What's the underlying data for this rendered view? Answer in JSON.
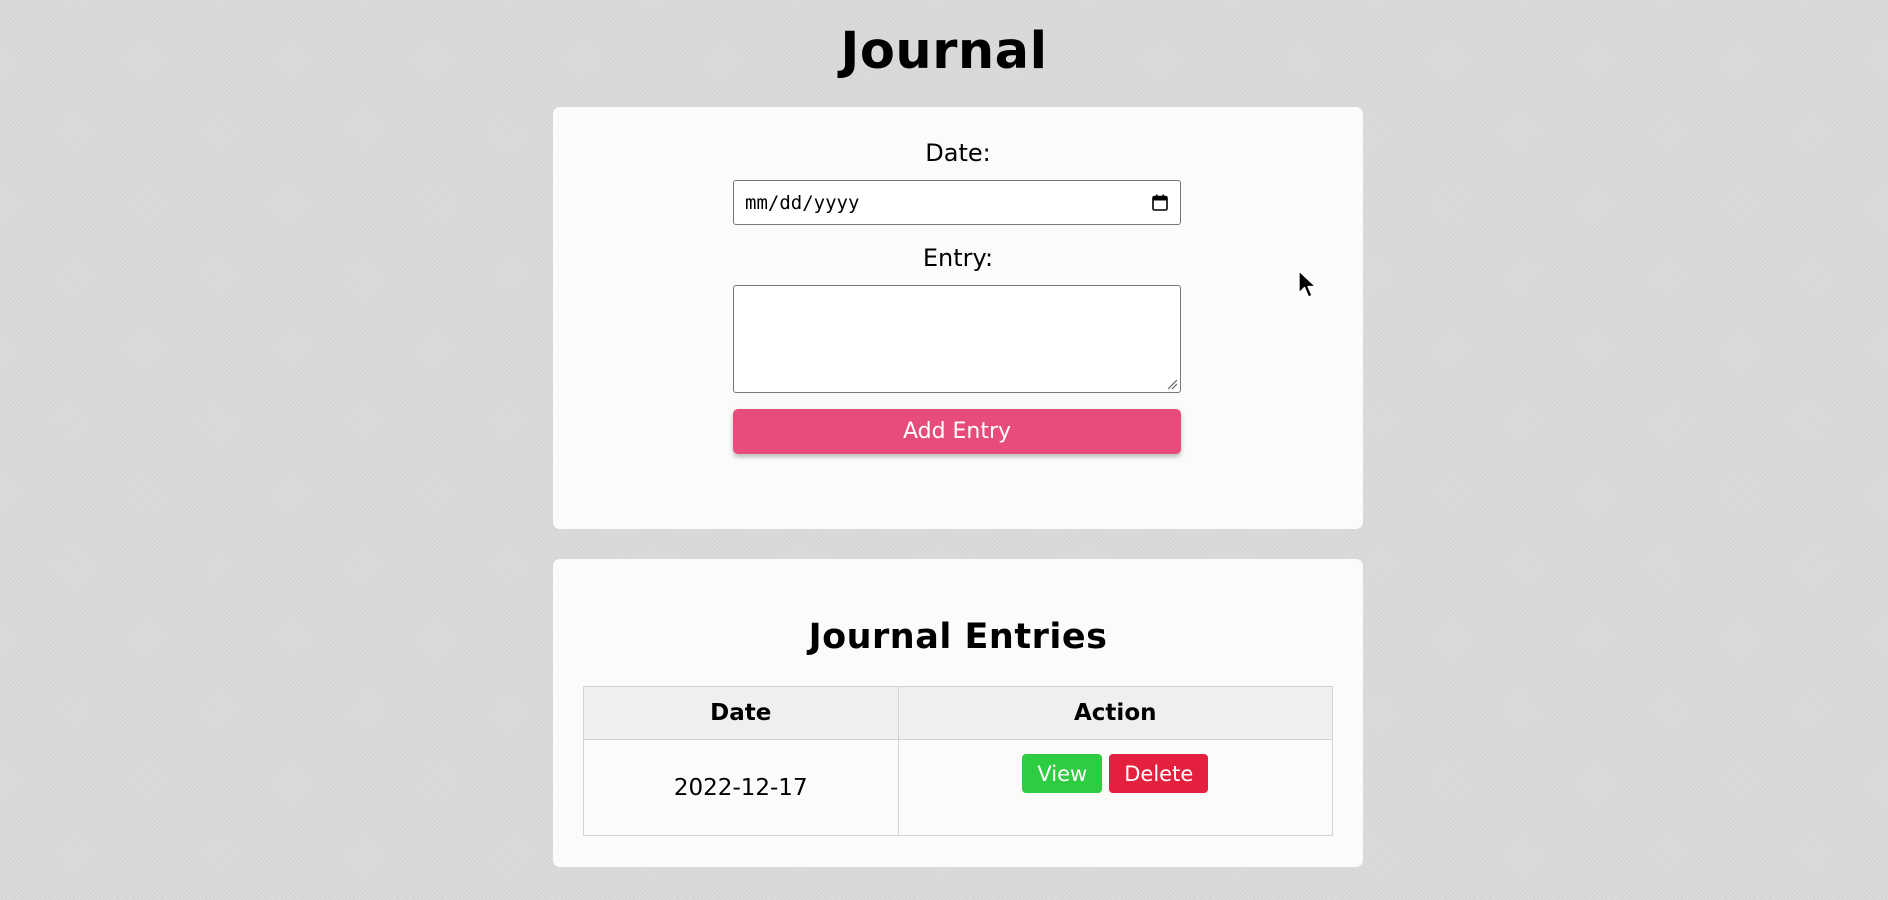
{
  "page": {
    "title": "Journal"
  },
  "form": {
    "date_label": "Date:",
    "date_placeholder": "mm/dd/yyyy",
    "calendar_icon": "calendar-icon",
    "entry_label": "Entry:",
    "entry_value": "",
    "add_button_label": "Add Entry"
  },
  "entries": {
    "title": "Journal Entries",
    "columns": [
      "Date",
      "Action"
    ],
    "rows": [
      {
        "date": "2022-12-17",
        "view_label": "View",
        "delete_label": "Delete"
      }
    ]
  },
  "colors": {
    "background": "#dcdcda",
    "card": "#fbfbfa",
    "add_button": "#e74c7c",
    "view_button": "#2ecc40",
    "delete_button": "#e4203f"
  }
}
